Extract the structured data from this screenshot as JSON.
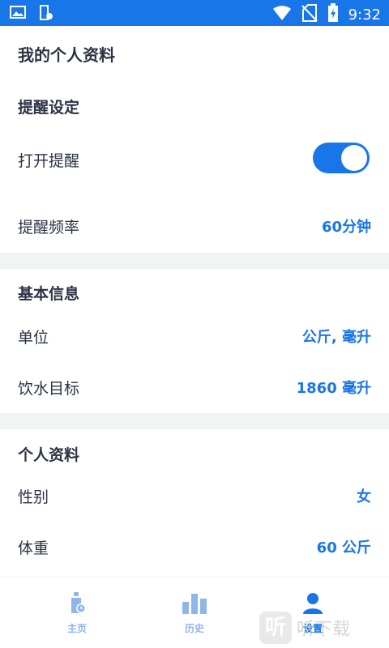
{
  "status_bar": {
    "time": "9:32",
    "icons": [
      "image-icon",
      "cup-notification-icon",
      "wifi-icon",
      "no-sim-icon",
      "battery-charging-icon"
    ]
  },
  "page_title": "我的个人资料",
  "sections": {
    "reminder": {
      "title": "提醒设定",
      "open_reminder_label": "打开提醒",
      "open_reminder_on": true,
      "frequency_label": "提醒频率",
      "frequency_value": "60分钟"
    },
    "basic": {
      "title": "基本信息",
      "unit_label": "单位",
      "unit_value": "公斤, 毫升",
      "goal_label": "饮水目标",
      "goal_value": "1860 毫升"
    },
    "profile": {
      "title": "个人资料",
      "gender_label": "性别",
      "gender_value": "女",
      "weight_label": "体重",
      "weight_value": "60 公斤"
    }
  },
  "bottom_nav": {
    "items": [
      {
        "label": "主页",
        "icon": "bottle-icon"
      },
      {
        "label": "历史",
        "icon": "bar-chart-icon"
      },
      {
        "label": "设置",
        "icon": "person-icon"
      }
    ],
    "active_index": 2
  },
  "watermark": {
    "glyph": "听",
    "text": "听下载"
  },
  "colors": {
    "accent": "#1976e8",
    "inactive": "#8fb5ea",
    "divider": "#f2f3f5"
  }
}
